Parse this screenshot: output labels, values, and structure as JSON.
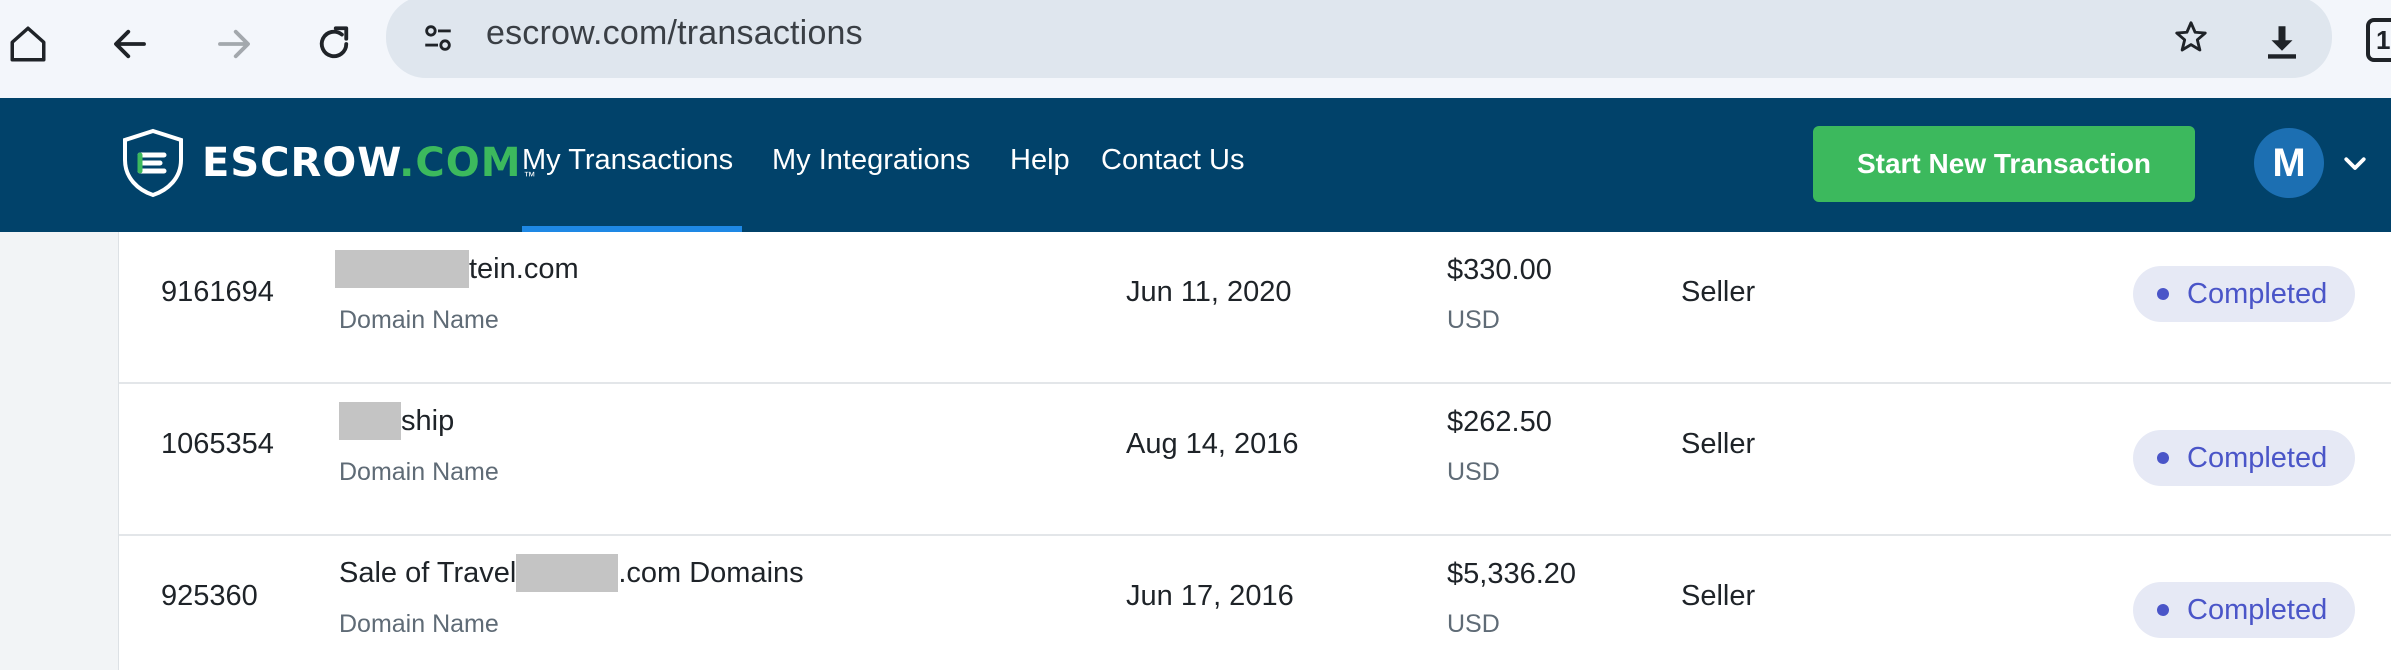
{
  "browser": {
    "url": "escrow.com/transactions",
    "tab_count": "1"
  },
  "header": {
    "logo_word": "ESCROW",
    "logo_suffix": ".COM",
    "logo_tm": "™",
    "nav": [
      "My Transactions",
      "My Integrations",
      "Help",
      "Contact Us"
    ],
    "active_nav": "My Transactions",
    "start_button": "Start New Transaction",
    "avatar_initial": "M"
  },
  "colors": {
    "header_bg": "#01426a",
    "brand_green": "#3cb95d",
    "active_underline": "#1e88e5",
    "status_text": "#4a55c8",
    "status_bg": "#e6e9f5"
  },
  "transactions": [
    {
      "id": "9161694",
      "title_prefix": "",
      "title_suffix": "tein.com",
      "type": "Domain Name",
      "date": "Jun 11, 2020",
      "amount": "$330.00",
      "currency": "USD",
      "role": "Seller",
      "status": "Completed"
    },
    {
      "id": "1065354",
      "title_prefix": "",
      "title_suffix": "ship",
      "type": "Domain Name",
      "date": "Aug 14, 2016",
      "amount": "$262.50",
      "currency": "USD",
      "role": "Seller",
      "status": "Completed"
    },
    {
      "id": "925360",
      "title_prefix": "Sale of Travel",
      "title_suffix": ".com Domains",
      "type": "Domain Name",
      "date": "Jun 17, 2016",
      "amount": "$5,336.20",
      "currency": "USD",
      "role": "Seller",
      "status": "Completed"
    }
  ]
}
